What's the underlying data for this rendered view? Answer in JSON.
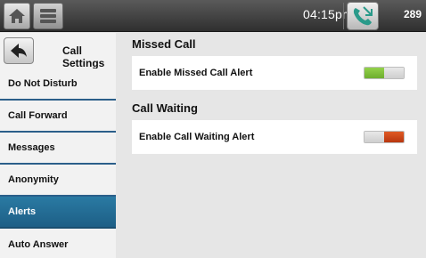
{
  "topbar": {
    "time": "04:15pm",
    "extension": "289",
    "icons": {
      "home": "home-icon",
      "menu": "menu-icon",
      "call": "phone-icon"
    }
  },
  "sidebar": {
    "title": "Call Settings",
    "back_icon": "back-arrow-icon",
    "items": [
      {
        "label": "Do Not Disturb",
        "active": false
      },
      {
        "label": "Call Forward",
        "active": false
      },
      {
        "label": "Messages",
        "active": false
      },
      {
        "label": "Anonymity",
        "active": false
      },
      {
        "label": "Alerts",
        "active": true
      },
      {
        "label": "Auto Answer",
        "active": false
      }
    ]
  },
  "main": {
    "sections": [
      {
        "title": "Missed Call",
        "row_label": "Enable Missed Call Alert",
        "enabled": true
      },
      {
        "title": "Call Waiting",
        "row_label": "Enable Call Waiting Alert",
        "enabled": false
      }
    ]
  },
  "colors": {
    "accent_blue": "#1d5f86",
    "toggle_on": "#7cc23a",
    "toggle_off": "#c8431a"
  }
}
